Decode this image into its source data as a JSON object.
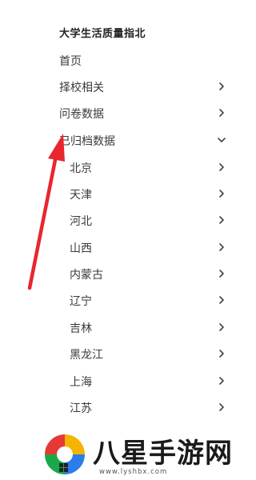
{
  "app": {
    "title": "大学生活质量指北"
  },
  "nav": [
    {
      "label": "首页",
      "chevron": "none"
    },
    {
      "label": "择校相关",
      "chevron": "right"
    },
    {
      "label": "问卷数据",
      "chevron": "right"
    },
    {
      "label": "已归档数据",
      "chevron": "down"
    }
  ],
  "provinces": [
    {
      "label": "北京"
    },
    {
      "label": "天津"
    },
    {
      "label": "河北"
    },
    {
      "label": "山西"
    },
    {
      "label": "内蒙古"
    },
    {
      "label": "辽宁"
    },
    {
      "label": "吉林"
    },
    {
      "label": "黑龙江"
    },
    {
      "label": "上海"
    },
    {
      "label": "江苏"
    }
  ],
  "annotation": {
    "icon": "red-arrow-icon",
    "color": "#e8262e"
  },
  "watermark": {
    "title": "八星手游网",
    "url": "www.lyshbx.com",
    "icon": "colorful-logo-icon"
  }
}
